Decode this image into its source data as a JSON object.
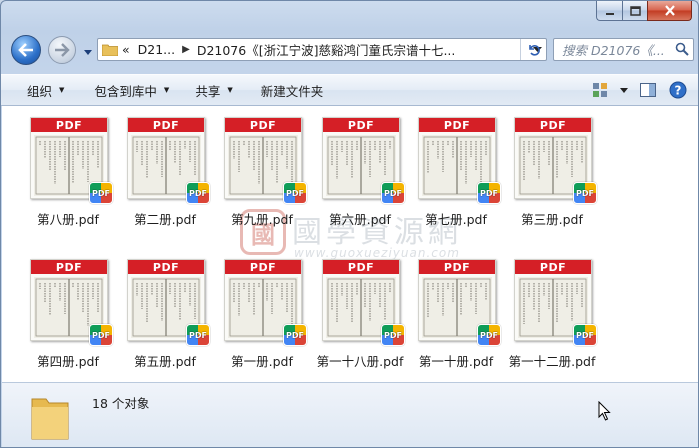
{
  "window": {
    "caption_buttons": [
      "minimize",
      "maximize",
      "close"
    ]
  },
  "address": {
    "overflow": "«",
    "segments": [
      "D21...",
      "D21076《[浙江宁波]慈谿鸿门童氏宗谱十七..."
    ]
  },
  "search": {
    "placeholder": "搜索 D21076《..."
  },
  "toolbar": {
    "organize": "组织",
    "include_in_library": "包含到库中",
    "share": "共享",
    "new_folder": "新建文件夹"
  },
  "files": [
    {
      "name": "第八册.pdf"
    },
    {
      "name": "第二册.pdf"
    },
    {
      "name": "第九册.pdf"
    },
    {
      "name": "第六册.pdf"
    },
    {
      "name": "第七册.pdf"
    },
    {
      "name": "第三册.pdf"
    },
    {
      "name": "第四册.pdf"
    },
    {
      "name": "第五册.pdf"
    },
    {
      "name": "第一册.pdf"
    },
    {
      "name": "第一十八册.pdf"
    },
    {
      "name": "第一十册.pdf"
    },
    {
      "name": "第一十二册.pdf"
    }
  ],
  "thumbnail_banner": "PDF",
  "badge_text": "PDF",
  "watermark": {
    "seal": "國",
    "title": "國學資源網",
    "url": "www.guoxueziyuan.com"
  },
  "status": {
    "count": "18 个对象"
  },
  "colors": {
    "banner": "#d51f26",
    "accent": "#2b6fc8"
  }
}
